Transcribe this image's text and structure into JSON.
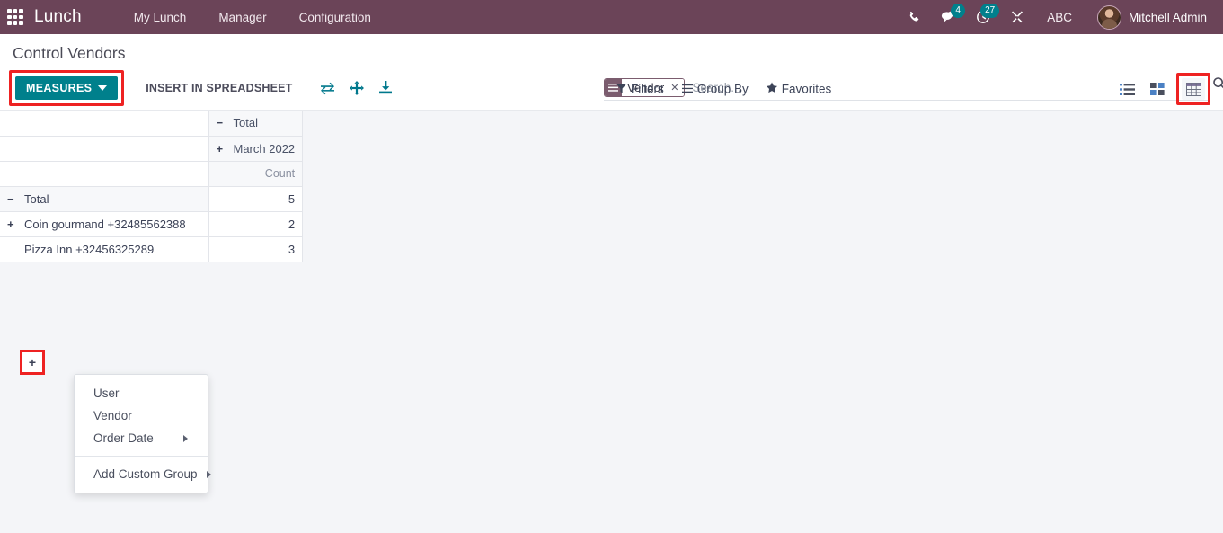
{
  "navbar": {
    "apps_icon": "apps-grid-icon",
    "brand": "Lunch",
    "menu": [
      {
        "label": "My Lunch"
      },
      {
        "label": "Manager"
      },
      {
        "label": "Configuration"
      }
    ],
    "sys_icons": [
      {
        "name": "phone-icon",
        "badge": null
      },
      {
        "name": "messaging-icon",
        "badge": "4"
      },
      {
        "name": "activity-clock-icon",
        "badge": "27"
      },
      {
        "name": "debug-tools-icon",
        "badge": null
      }
    ],
    "company": "ABC",
    "user": "Mitchell Admin",
    "bg_color": "#6b4458",
    "badge_color": "#00808c"
  },
  "control_panel": {
    "breadcrumb": "Control Vendors",
    "measures_label": "MEASURES",
    "insert_spreadsheet_label": "INSERT IN SPREADSHEET",
    "pivot_icons": [
      {
        "name": "flip-axis-icon"
      },
      {
        "name": "expand-all-icon"
      },
      {
        "name": "download-xlsx-icon"
      }
    ],
    "accent_color": "#00808c",
    "highlight_color": "#ee2222"
  },
  "search": {
    "facet": {
      "label": "Vendor",
      "icon": "group-by-lines-icon",
      "close": "✕"
    },
    "placeholder": "Search...",
    "value": "",
    "search_icon": "search-icon"
  },
  "search_buttons": [
    {
      "name": "filters",
      "label": "Filters",
      "icon": "filter-funnel-icon"
    },
    {
      "name": "group-by",
      "label": "Group By",
      "icon": "group-by-lines-icon"
    },
    {
      "name": "favorites",
      "label": "Favorites",
      "icon": "star-icon"
    }
  ],
  "view_switcher": [
    {
      "name": "list-view",
      "active": false
    },
    {
      "name": "kanban-view",
      "active": false
    },
    {
      "name": "pivot-view",
      "active": true
    }
  ],
  "pivot": {
    "col_headers": {
      "total": {
        "label": "Total",
        "toggle": "−"
      },
      "period": {
        "label": "March 2022",
        "toggle": "+"
      },
      "measure": "Count"
    },
    "rows": [
      {
        "label": "Total",
        "toggle": "−",
        "indent": 0,
        "value": "5",
        "is_total": true
      },
      {
        "label": "Coin gourmand +32485562388",
        "toggle": "+",
        "indent": 1,
        "value": "2",
        "is_total": false
      },
      {
        "label": "Pizza Inn +32456325289",
        "toggle": "+",
        "indent": 1,
        "value": "3",
        "is_total": false
      }
    ]
  },
  "groupby_menu": {
    "items": [
      {
        "label": "User",
        "has_submenu": false
      },
      {
        "label": "Vendor",
        "has_submenu": false
      },
      {
        "label": "Order Date",
        "has_submenu": true
      }
    ],
    "custom": {
      "label": "Add Custom Group",
      "has_submenu": true
    }
  }
}
